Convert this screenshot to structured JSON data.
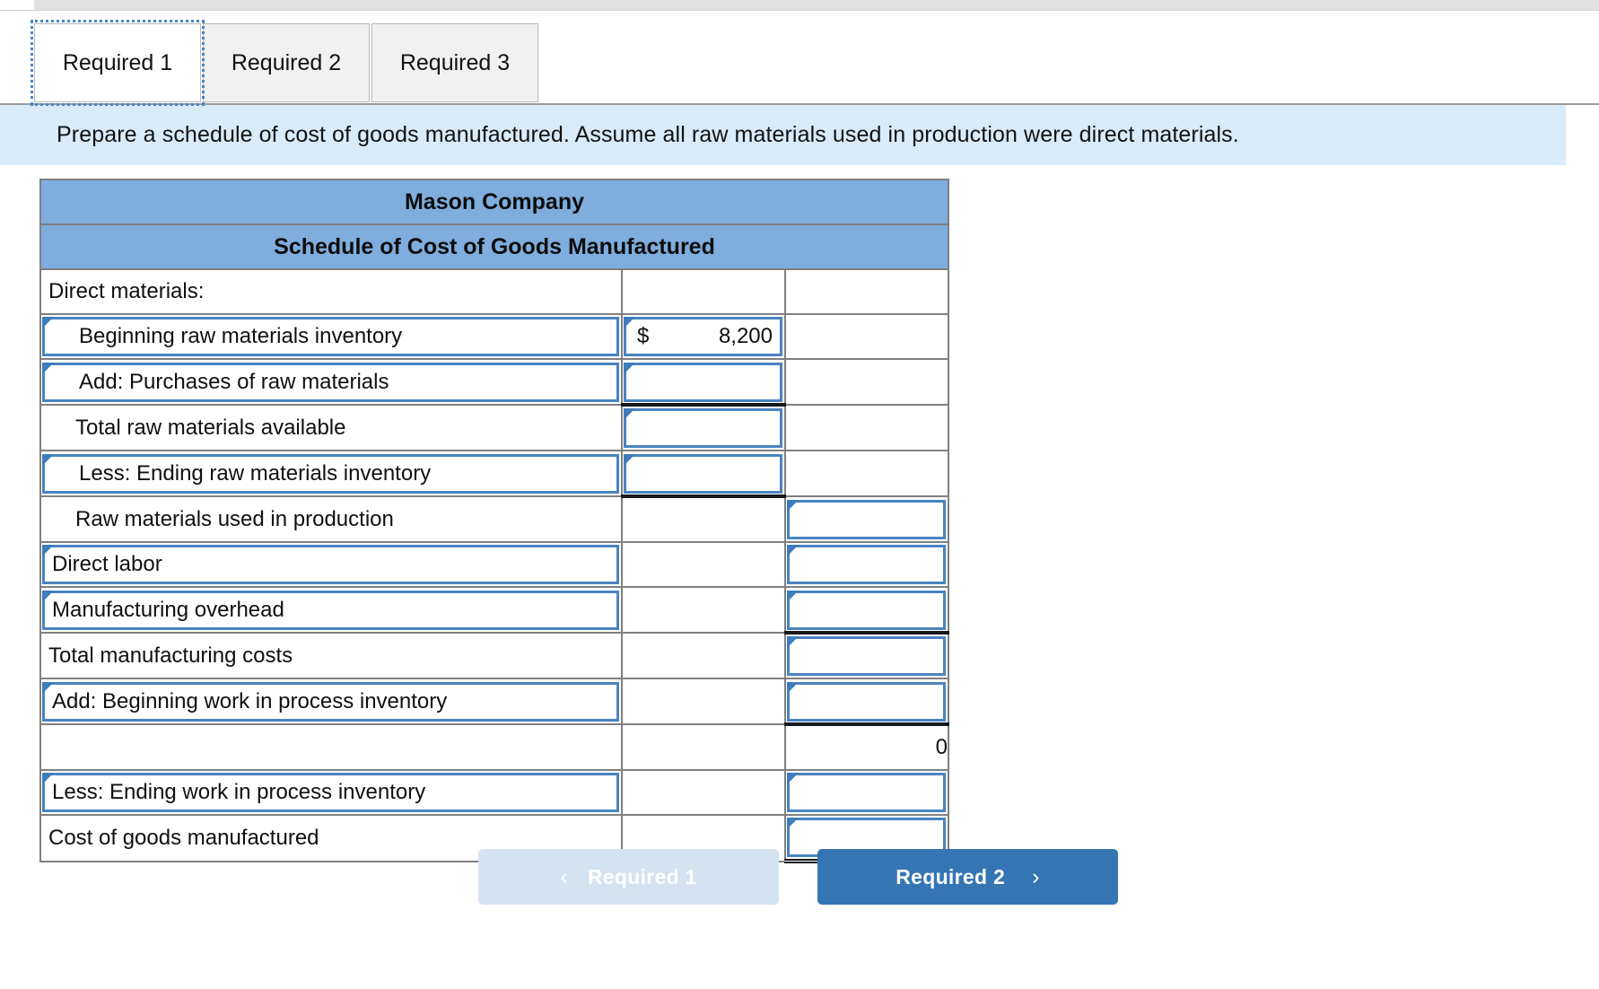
{
  "tabs": [
    {
      "label": "Required 1",
      "active": true
    },
    {
      "label": "Required 2",
      "active": false
    },
    {
      "label": "Required 3",
      "active": false
    }
  ],
  "instruction": "Prepare a schedule of cost of goods manufactured. Assume all raw materials used in production were direct materials.",
  "sheet": {
    "company": "Mason Company",
    "statement_title": "Schedule of Cost of Goods Manufactured",
    "rows": [
      {
        "label": "Direct materials:",
        "amount1": "",
        "amount2": ""
      },
      {
        "label": "Beginning raw materials inventory",
        "currency": "$",
        "amount1": "8,200",
        "amount2": ""
      },
      {
        "label": "Add: Purchases of raw materials",
        "amount1": "",
        "amount2": ""
      },
      {
        "label": "Total raw materials available",
        "amount1": "",
        "amount2": ""
      },
      {
        "label": "Less: Ending raw materials inventory",
        "amount1": "",
        "amount2": ""
      },
      {
        "label": "Raw materials used in production",
        "amount1": "",
        "amount2": ""
      },
      {
        "label": "Direct labor",
        "amount1": "",
        "amount2": ""
      },
      {
        "label": "Manufacturing overhead",
        "amount1": "",
        "amount2": ""
      },
      {
        "label": "Total manufacturing costs",
        "amount1": "",
        "amount2": ""
      },
      {
        "label": "Add: Beginning work in process inventory",
        "amount1": "",
        "amount2": ""
      },
      {
        "label": "",
        "amount1": "",
        "amount2": "0"
      },
      {
        "label": "Less: Ending work in process inventory",
        "amount1": "",
        "amount2": ""
      },
      {
        "label": "Cost of goods manufactured",
        "amount1": "",
        "amount2": ""
      }
    ]
  },
  "footer": {
    "prev_label": "Required 1",
    "prev_chevron": "‹",
    "next_label": "Required 2",
    "next_chevron": "›"
  },
  "colors": {
    "header_blue": "#7eadde",
    "banner_blue": "#d9eaf8",
    "input_border": "#4a84c0",
    "next_button": "#3575b4",
    "prev_button": "#d5e3f1"
  }
}
